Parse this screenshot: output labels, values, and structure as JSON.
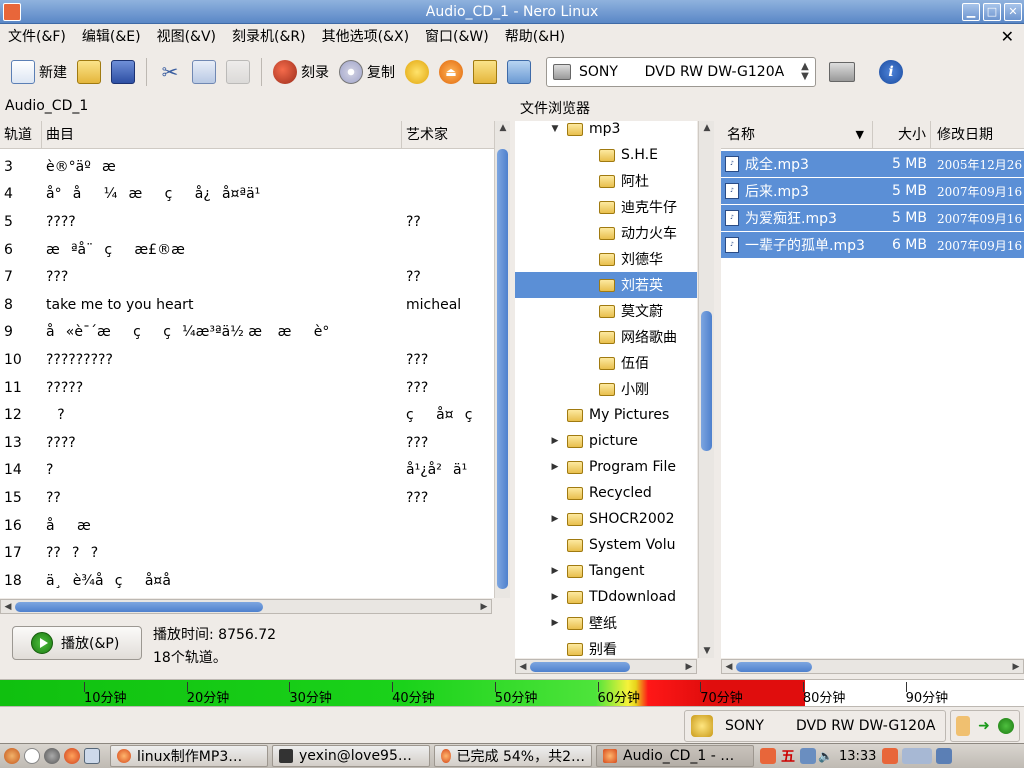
{
  "window": {
    "title": "Audio_CD_1 - Nero Linux"
  },
  "menu": [
    "文件(&F)",
    "编辑(&E)",
    "视图(&V)",
    "刻录机(&R)",
    "其他选项(&X)",
    "窗口(&W)",
    "帮助(&H)"
  ],
  "toolbar": {
    "new_label": "新建",
    "burn_label": "刻录",
    "copy_label": "复制",
    "drive_select": "SONY      DVD RW DW-G120A"
  },
  "compilation": {
    "title": "Audio_CD_1",
    "columns": [
      "轨道",
      "曲目",
      "艺术家"
    ],
    "tracks": [
      {
        "num": "3",
        "title": "è®°äºæ",
        "artist": ""
      },
      {
        "num": "4",
        "title": "å°å¼æçå¿å¤ªä¹",
        "artist": ""
      },
      {
        "num": "5",
        "title": "????",
        "artist": "??"
      },
      {
        "num": "6",
        "title": "æªå¨çæ£®æ",
        "artist": ""
      },
      {
        "num": "7",
        "title": "???",
        "artist": "??"
      },
      {
        "num": "8",
        "title": "take me to you heart",
        "artist": "micheal"
      },
      {
        "num": "9",
        "title": "å«è¯´æçç¼æ³ªä½ æ  æè°",
        "artist": ""
      },
      {
        "num": "10",
        "title": "?????????",
        "artist": "???"
      },
      {
        "num": "11",
        "title": "?????",
        "artist": "???"
      },
      {
        "num": "12",
        "title": "?",
        "artist": "çå¤ç"
      },
      {
        "num": "13",
        "title": "????",
        "artist": "???"
      },
      {
        "num": "14",
        "title": "?",
        "artist": "å¹¿å²ä¹"
      },
      {
        "num": "15",
        "title": "??",
        "artist": "???"
      },
      {
        "num": "16",
        "title": "åæ",
        "artist": ""
      },
      {
        "num": "17",
        "title": "????",
        "artist": ""
      },
      {
        "num": "18",
        "title": "ä¸è¾å­çå¤å",
        "artist": ""
      }
    ]
  },
  "play": {
    "button_label": "播放(&P)",
    "time_text": "播放时间: 8756.72",
    "tracks_text": "18个轨道。"
  },
  "browser": {
    "title": "文件浏览器",
    "tree": [
      {
        "label": "mp3",
        "level": 1,
        "expander": "▼"
      },
      {
        "label": "S.H.E",
        "level": 2,
        "expander": ""
      },
      {
        "label": "阿杜",
        "level": 2,
        "expander": ""
      },
      {
        "label": "迪克牛仔",
        "level": 2,
        "expander": ""
      },
      {
        "label": "动力火车",
        "level": 2,
        "expander": ""
      },
      {
        "label": "刘德华",
        "level": 2,
        "expander": ""
      },
      {
        "label": "刘若英",
        "level": 2,
        "expander": "",
        "selected": true
      },
      {
        "label": "莫文蔚",
        "level": 2,
        "expander": ""
      },
      {
        "label": "网络歌曲",
        "level": 2,
        "expander": ""
      },
      {
        "label": "伍佰",
        "level": 2,
        "expander": ""
      },
      {
        "label": "小刚",
        "level": 2,
        "expander": ""
      },
      {
        "label": "My Pictures",
        "level": 1,
        "expander": ""
      },
      {
        "label": "picture",
        "level": 1,
        "expander": "▶"
      },
      {
        "label": "Program File",
        "level": 1,
        "expander": "▶"
      },
      {
        "label": "Recycled",
        "level": 1,
        "expander": ""
      },
      {
        "label": "SHOCR2002",
        "level": 1,
        "expander": "▶"
      },
      {
        "label": "System Volu",
        "level": 1,
        "expander": ""
      },
      {
        "label": "Tangent",
        "level": 1,
        "expander": "▶"
      },
      {
        "label": "TDdownload",
        "level": 1,
        "expander": "▶"
      },
      {
        "label": "壁纸",
        "level": 1,
        "expander": "▶"
      },
      {
        "label": "别看",
        "level": 1,
        "expander": ""
      }
    ],
    "file_columns": [
      "名称",
      "大小",
      "修改日期"
    ],
    "files": [
      {
        "name": "成全.mp3",
        "size": "5 MB",
        "date": "2005年12月26"
      },
      {
        "name": "后来.mp3",
        "size": "5 MB",
        "date": "2007年09月16"
      },
      {
        "name": "为爱痴狂.mp3",
        "size": "5 MB",
        "date": "2007年09月16"
      },
      {
        "name": "一辈子的孤单.mp3",
        "size": "6 MB",
        "date": "2007年09月16"
      }
    ]
  },
  "capacity": {
    "used_fraction": 0.885,
    "ticks": [
      "10分钟",
      "20分钟",
      "30分钟",
      "40分钟",
      "50分钟",
      "60分钟",
      "70分钟",
      "80分钟",
      "90分钟"
    ],
    "colors": {
      "green": "#10c00f",
      "yellow": "#f6f23a",
      "red": "#ff1717"
    }
  },
  "status": {
    "brand": "SONY",
    "model": "DVD RW DW-G120A"
  },
  "taskbar": {
    "tasks": [
      "linux制作MP3…",
      "yexin@love95…",
      "已完成 54%，共2…",
      "Audio_CD_1 - …"
    ],
    "ime": "五",
    "clock": "13:33"
  }
}
